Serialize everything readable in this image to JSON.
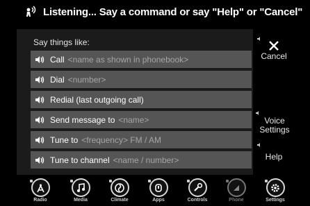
{
  "header": {
    "title": "Listening... Say a command or say \"Help\" or \"Cancel\"",
    "icon": "voice-recognition-icon"
  },
  "main": {
    "intro": "Say things like:",
    "commands": [
      {
        "label": "Call",
        "placeholder": "<name as shown in phonebook>"
      },
      {
        "label": "Dial",
        "placeholder": "<number>"
      },
      {
        "label": "Redial (last outgoing call)",
        "placeholder": ""
      },
      {
        "label": "Send message to",
        "placeholder": "<name>"
      },
      {
        "label": "Tune to",
        "placeholder": "<frequency> FM / AM"
      },
      {
        "label": "Tune to channel",
        "placeholder": "<name / number>"
      }
    ]
  },
  "side": {
    "cancel": "Cancel",
    "voice_settings": "Voice Settings",
    "help": "Help"
  },
  "nav": {
    "items": [
      {
        "label": "Radio",
        "icon": "radio-icon"
      },
      {
        "label": "Media",
        "icon": "media-icon"
      },
      {
        "label": "Climate",
        "icon": "climate-icon"
      },
      {
        "label": "Apps",
        "icon": "apps-icon"
      },
      {
        "label": "Controls",
        "icon": "controls-icon"
      },
      {
        "label": "Phone",
        "icon": "phone-icon"
      },
      {
        "label": "Settings",
        "icon": "settings-icon"
      }
    ]
  }
}
